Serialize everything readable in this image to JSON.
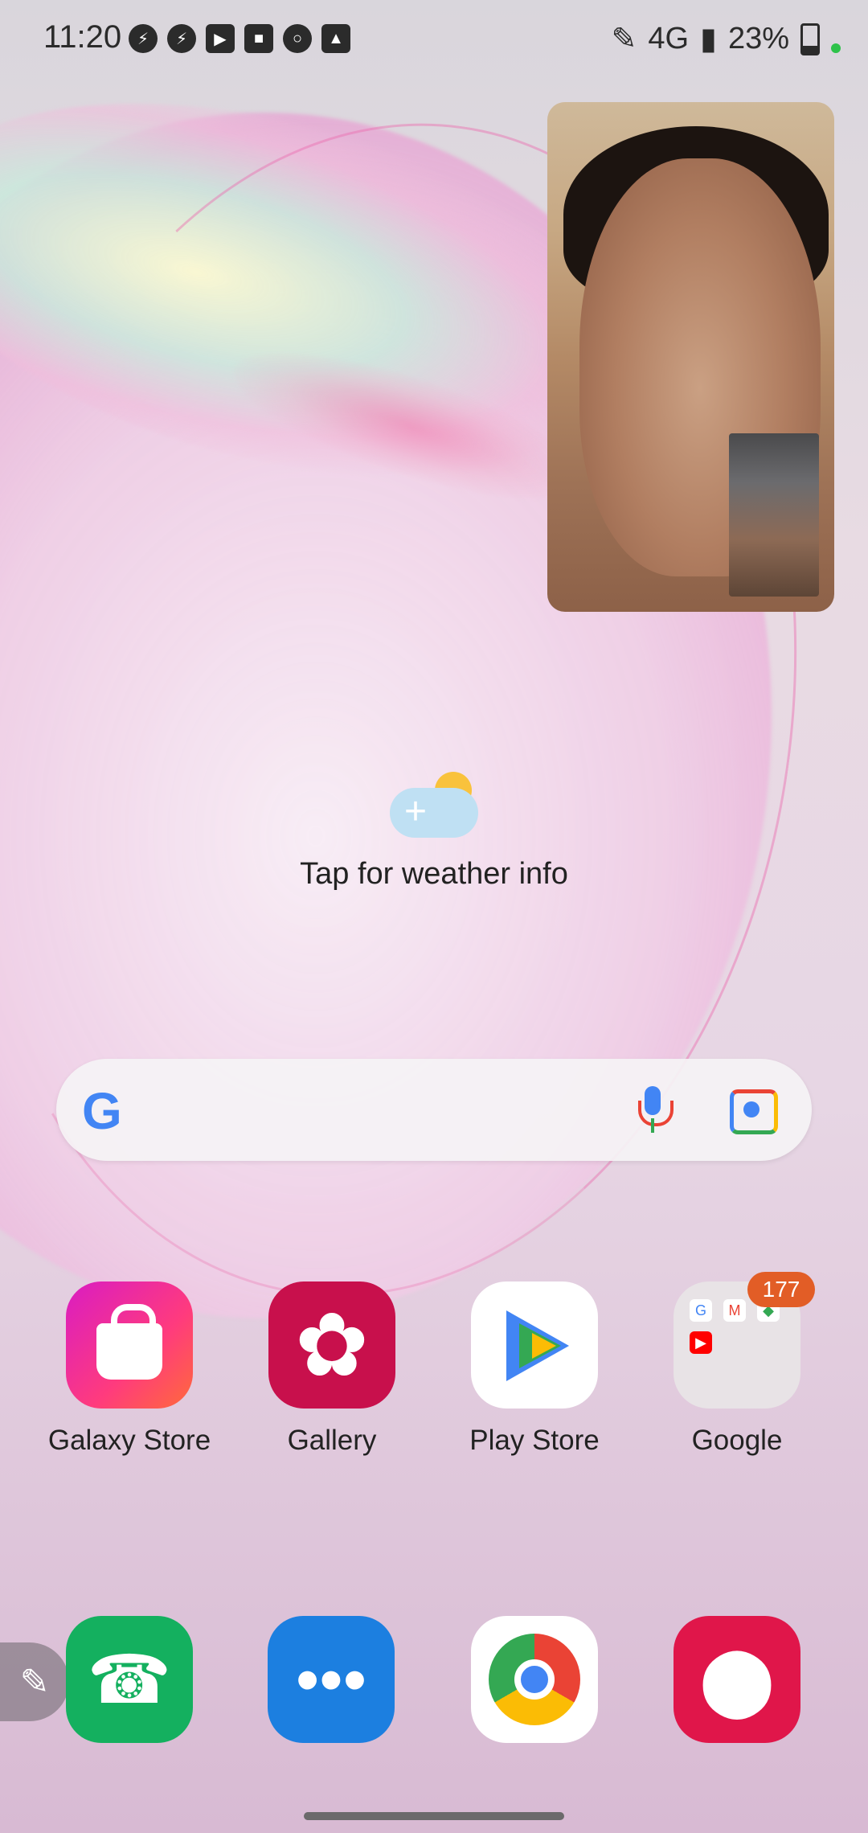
{
  "status": {
    "time": "11:20",
    "network": "4G",
    "battery": "23%",
    "notification_icons": [
      "messenger-icon",
      "messenger-icon",
      "youtube-icon",
      "video-camera-icon",
      "circle-record-icon",
      "image-icon"
    ]
  },
  "weather": {
    "label": "Tap for weather info"
  },
  "search": {
    "logo": "G"
  },
  "apps": [
    {
      "label": "Galaxy Store",
      "icon": "galaxy-store-icon"
    },
    {
      "label": "Gallery",
      "icon": "gallery-icon"
    },
    {
      "label": "Play Store",
      "icon": "play-store-icon"
    },
    {
      "label": "Google",
      "icon": "google-folder-icon",
      "badge": "177"
    }
  ],
  "dock": [
    {
      "icon": "phone-icon"
    },
    {
      "icon": "messages-icon"
    },
    {
      "icon": "chrome-icon"
    },
    {
      "icon": "camera-icon"
    }
  ],
  "colors": {
    "badge": "#e25d26",
    "galaxy_store": "#ff3b7d",
    "gallery": "#c8104c",
    "phone": "#14b05f",
    "messages": "#1c7fe0",
    "camera": "#e0164a"
  }
}
